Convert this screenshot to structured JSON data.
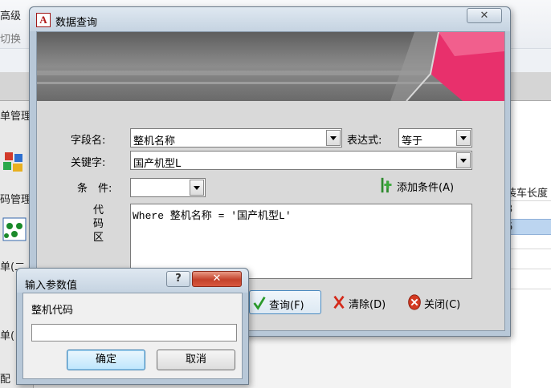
{
  "background": {
    "ribbon_top_left_text": "高级",
    "ribbon_left_cut_text": "切换",
    "nav_header": "单管理",
    "nav_items": [
      "码管理",
      "单(二",
      "单(",
      "配"
    ],
    "sheet_header": "装车长度",
    "sheet_cells": [
      "3",
      "6"
    ]
  },
  "query_dialog": {
    "title": "数据查询",
    "close_glyph": "✕",
    "field_name_label": "字段名:",
    "field_name_value": "整机名称",
    "expression_label": "表达式:",
    "expression_value": "等于",
    "keyword_label": "关键字:",
    "keyword_value": "国产机型L",
    "condition_label": "条　件:",
    "condition_value": "",
    "add_condition_label": "添加条件(A)",
    "code_area_label": "代码区",
    "code_text": "Where 整机名称 = '国产机型L'",
    "query_button": "查询(F)",
    "clear_button": "清除(D)",
    "close_button": "关闭(C)"
  },
  "param_dialog": {
    "title": "输入参数值",
    "help_glyph": "?",
    "close_glyph": "✕",
    "prompt": "整机代码",
    "input_value": "",
    "ok_button": "确定",
    "cancel_button": "取消"
  },
  "colors": {
    "titlebar": "#c5d3e1",
    "banner_accent": "#e8306c",
    "close_button_red": "#c4422b"
  }
}
